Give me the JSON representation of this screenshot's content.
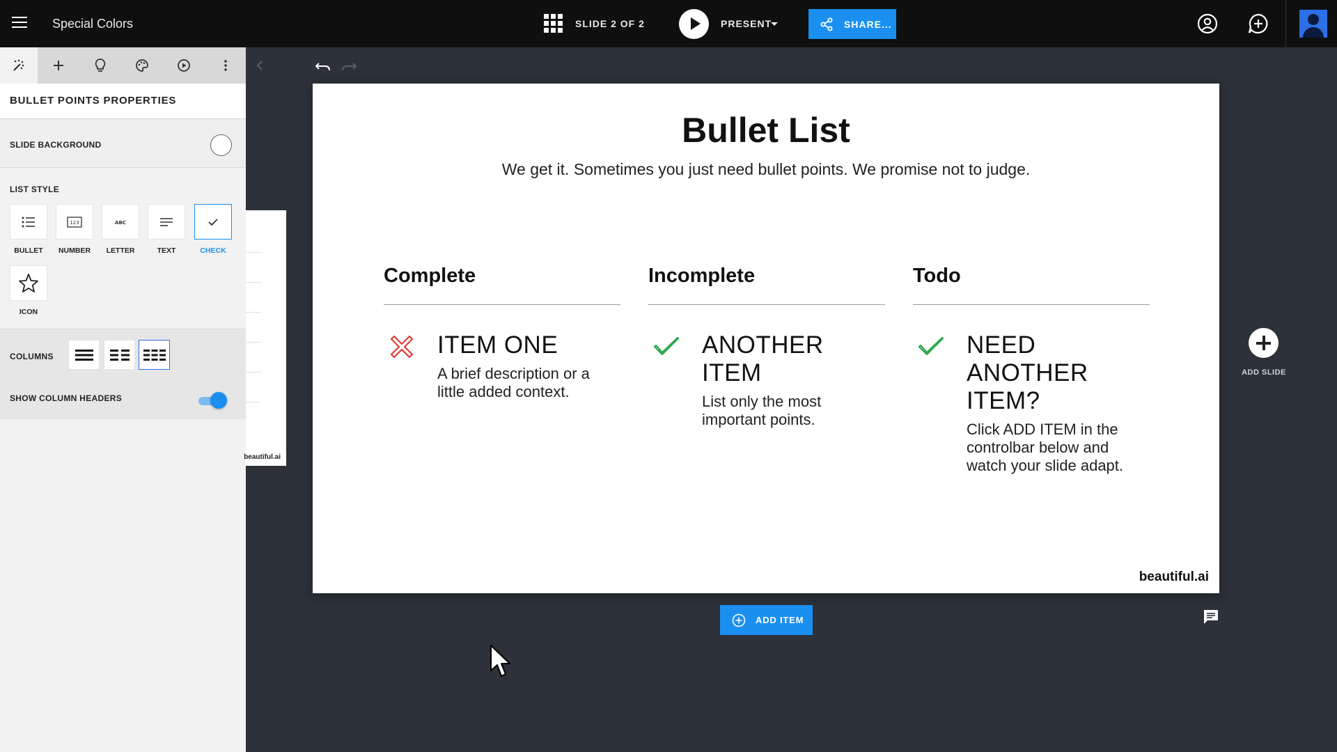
{
  "app": {
    "doc_title": "Special Colors",
    "slide_counter": "SLIDE 2 OF 2",
    "present_label": "PRESENT",
    "share_label": "SHARE...",
    "accent_color": "#1a8ff0"
  },
  "panel": {
    "tabs": [
      {
        "icon": "magic-wand-icon",
        "active": true
      },
      {
        "icon": "plus-icon"
      },
      {
        "icon": "lightbulb-icon"
      },
      {
        "icon": "palette-icon"
      },
      {
        "icon": "play-circle-icon"
      },
      {
        "icon": "more-vertical-icon"
      }
    ],
    "title": "BULLET POINTS PROPERTIES",
    "slide_background_label": "SLIDE BACKGROUND",
    "list_style_label": "LIST STYLE",
    "list_styles": [
      {
        "label": "BULLET",
        "icon": "bullet-list-icon"
      },
      {
        "label": "NUMBER",
        "icon": "number-list-icon"
      },
      {
        "label": "LETTER",
        "icon": "letter-list-icon"
      },
      {
        "label": "TEXT",
        "icon": "text-lines-icon"
      },
      {
        "label": "CHECK",
        "icon": "check-icon",
        "selected": true
      },
      {
        "label": "ICON",
        "icon": "star-icon"
      }
    ],
    "columns_label": "COLUMNS",
    "columns_selected": 3,
    "show_column_headers_label": "SHOW COLUMN HEADERS",
    "show_column_headers": true
  },
  "slide": {
    "title": "Bullet List",
    "subtitle": "We get it. Sometimes you just need bullet points. We promise not to judge.",
    "columns": [
      {
        "header": "Complete",
        "item_title": "ITEM ONE",
        "item_desc": "A brief description or a little added context.",
        "icon": "cross-icon",
        "icon_color": "#e23b3b"
      },
      {
        "header": "Incomplete",
        "item_title": "ANOTHER ITEM",
        "item_desc": "List only the most important points.",
        "icon": "check-icon",
        "icon_color": "#2ea84a"
      },
      {
        "header": "Todo",
        "item_title": "NEED ANOTHER ITEM?",
        "item_desc": "Click ADD ITEM in the controlbar below and watch your slide adapt.",
        "icon": "check-icon",
        "icon_color": "#2ea84a"
      }
    ],
    "logo": "beautiful.ai"
  },
  "thumbnail_logo": "beautiful.ai",
  "add_slide_label": "ADD SLIDE",
  "add_item_label": "ADD ITEM"
}
